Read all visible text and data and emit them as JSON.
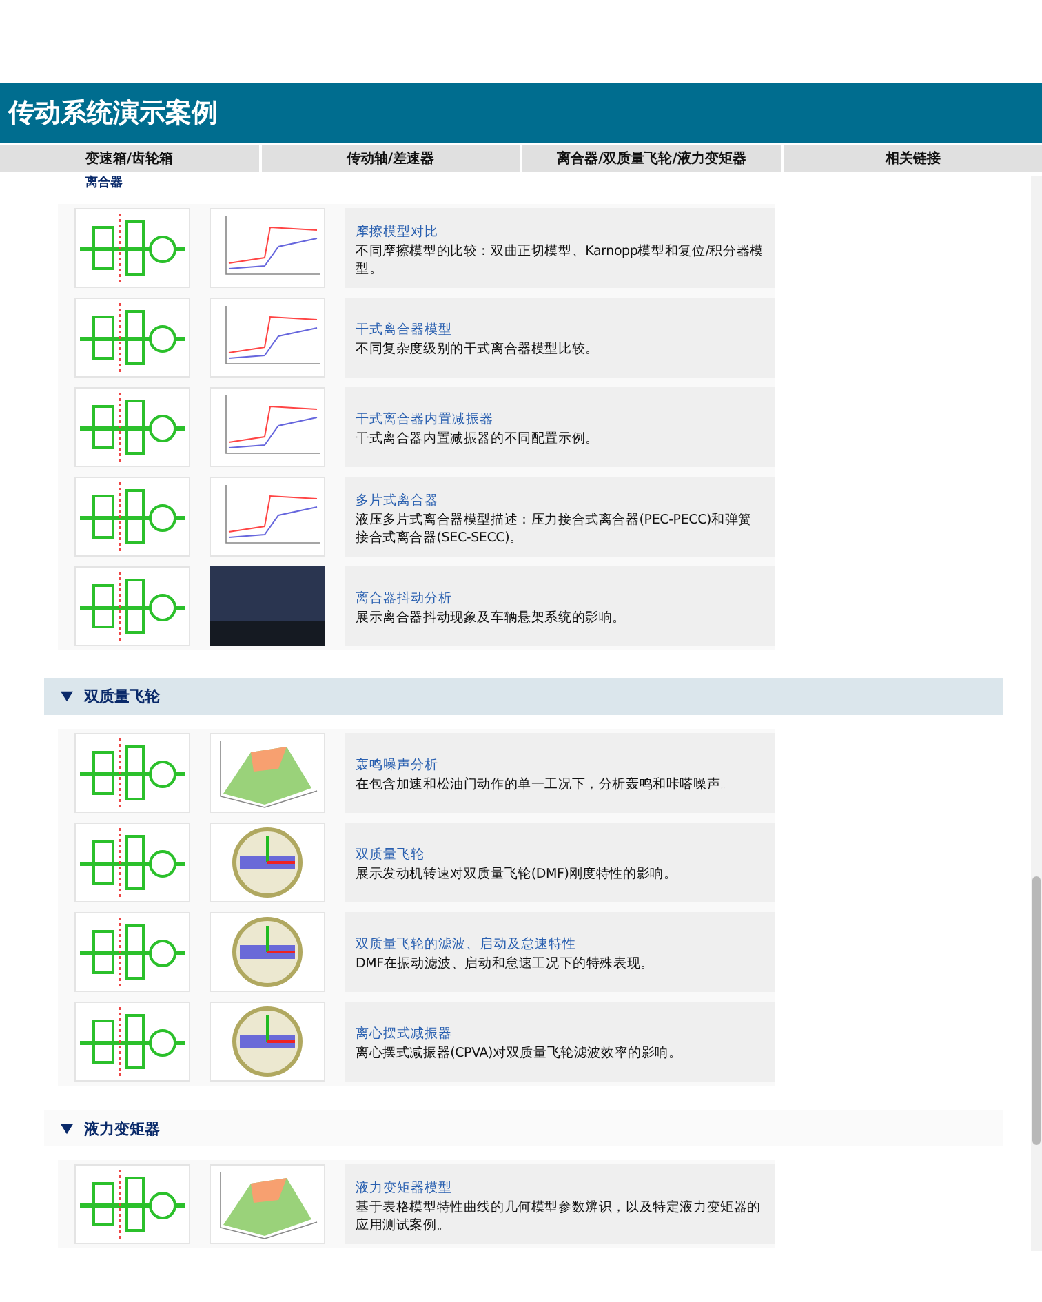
{
  "header": {
    "title": "传动系统演示案例"
  },
  "nav_tabs": [
    {
      "label": "变速箱/齿轮箱"
    },
    {
      "label": "传动轴/差速器"
    },
    {
      "label": "离合器/双质量飞轮/液力变矩器"
    },
    {
      "label": "相关链接"
    }
  ],
  "clipped_section": {
    "title": "离合器",
    "items": [
      {
        "title": "摩擦模型对比",
        "description": "不同摩擦模型的比较：双曲正切模型、Karnopp模型和复位/积分器模型。",
        "kind": "plot"
      },
      {
        "title": "干式离合器模型",
        "description": "不同复杂度级别的干式离合器模型比较。",
        "kind": "plot"
      },
      {
        "title": "干式离合器内置减振器",
        "description": "干式离合器内置减振器的不同配置示例。",
        "kind": "plot"
      },
      {
        "title": "多片式离合器",
        "description": "液压多片式离合器模型描述：压力接合式离合器(PEC-PECC)和弹簧接合式离合器(SEC-SECC)。",
        "kind": "plot"
      },
      {
        "title": "离合器抖动分析",
        "description": "展示离合器抖动现象及车辆悬架系统的影响。",
        "kind": "photo"
      }
    ]
  },
  "sections": [
    {
      "title": "双质量飞轮",
      "expanded": true,
      "items": [
        {
          "title": "轰鸣噪声分析",
          "description": "在包含加速和松油门动作的单一工况下，分析轰鸣和咔嗒噪声。",
          "kind": "surface"
        },
        {
          "title": "双质量飞轮",
          "description": "展示发动机转速对双质量飞轮(DMF)刚度特性的影响。",
          "kind": "model3d"
        },
        {
          "title": "双质量飞轮的滤波、启动及怠速特性",
          "description": "DMF在振动滤波、启动和怠速工况下的特殊表现。",
          "kind": "model3d"
        },
        {
          "title": "离心摆式减振器",
          "description": "离心摆式减振器(CPVA)对双质量飞轮滤波效率的影响。",
          "kind": "model3d"
        }
      ]
    },
    {
      "title": "液力变矩器",
      "expanded": true,
      "items": [
        {
          "title": "液力变矩器模型",
          "description": "基于表格模型特性曲线的几何模型参数辨识，以及特定液力变矩器的应用测试案例。",
          "kind": "surface"
        }
      ]
    }
  ]
}
